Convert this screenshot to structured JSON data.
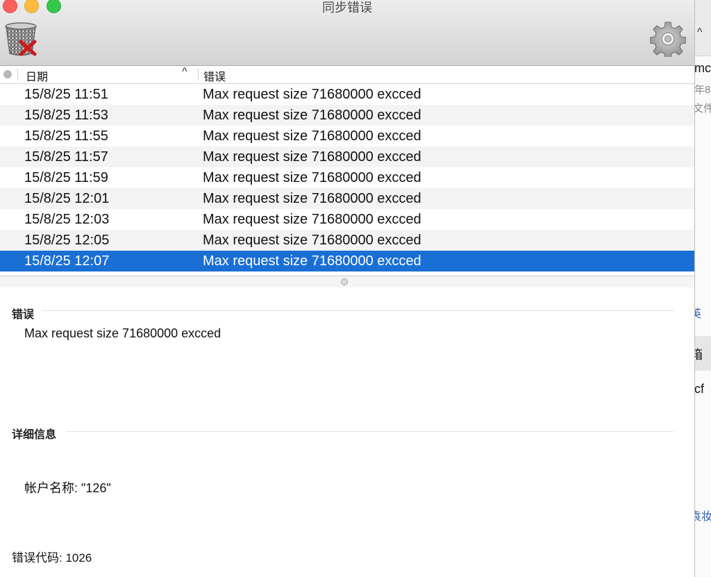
{
  "window": {
    "title": "同步错误"
  },
  "toolbar": {
    "delete_icon": "trash-delete-icon",
    "settings_icon": "gear-icon"
  },
  "table": {
    "columns": {
      "status": "",
      "date": "日期",
      "error": "错误"
    },
    "sort_indicator": "^",
    "rows": [
      {
        "date": "15/8/25 11:51",
        "error": "Max request size 71680000 excced"
      },
      {
        "date": "15/8/25 11:53",
        "error": "Max request size 71680000 excced"
      },
      {
        "date": "15/8/25 11:55",
        "error": "Max request size 71680000 excced"
      },
      {
        "date": "15/8/25 11:57",
        "error": "Max request size 71680000 excced"
      },
      {
        "date": "15/8/25 11:59",
        "error": "Max request size 71680000 excced"
      },
      {
        "date": "15/8/25 12:01",
        "error": "Max request size 71680000 excced"
      },
      {
        "date": "15/8/25 12:03",
        "error": "Max request size 71680000 excced"
      },
      {
        "date": "15/8/25 12:05",
        "error": "Max request size 71680000 excced"
      },
      {
        "date": "15/8/25 12:07",
        "error": "Max request size 71680000 excced"
      }
    ],
    "selected_index": 8
  },
  "detail": {
    "error_heading": "错误",
    "error_message": "Max request size 71680000 excced",
    "info_heading": "详细信息",
    "account_line": "帐户名称: \"126\"",
    "code_line": "错误代码: 1026"
  },
  "background_app": {
    "fragments": [
      "^",
      "mc",
      "年8",
      "文件",
      "英",
      "箱",
      "cf",
      "袁妆"
    ]
  },
  "colors": {
    "selection": "#1a6fd5",
    "close": "#fc605c",
    "minimize": "#fdbc40",
    "maximize": "#34c84a"
  }
}
